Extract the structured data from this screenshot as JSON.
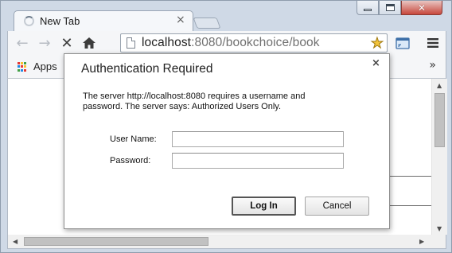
{
  "browser": {
    "tab_title": "New Tab",
    "tab_close_glyph": "×",
    "window_controls": {
      "minimize": "minimize-icon",
      "maximize": "maximize-icon",
      "close_glyph": "✕"
    },
    "toolbar": {
      "back_glyph": "←",
      "forward_glyph": "→",
      "stop_glyph": "✕",
      "home_icon": "home-icon",
      "url_host": "localhost",
      "url_rest": ":8080/bookchoice/book",
      "star_glyph": "★",
      "extension_icon": "cast-icon",
      "menu_icon": "hamburger-menu-icon"
    },
    "bookmarks_bar": {
      "apps_label": "Apps",
      "overflow_glyph": "»",
      "apps_colors": [
        "#e53935",
        "#fbc02d",
        "#43a047",
        "#1e88e5",
        "#e53935",
        "#fbc02d",
        "#43a047",
        "#1e88e5",
        "#e53935"
      ]
    },
    "scrollbars": {
      "up_glyph": "▲",
      "down_glyph": "▼",
      "left_glyph": "◀",
      "right_glyph": "▶"
    }
  },
  "dialog": {
    "title": "Authentication Required",
    "close_glyph": "×",
    "message_line1": "The server http://localhost:8080 requires a username and",
    "message_line2": "password. The server says: Authorized Users Only.",
    "username_label": "User Name:",
    "username_value": "",
    "password_label": "Password:",
    "password_value": "",
    "login_button": "Log In",
    "cancel_button": "Cancel"
  }
}
